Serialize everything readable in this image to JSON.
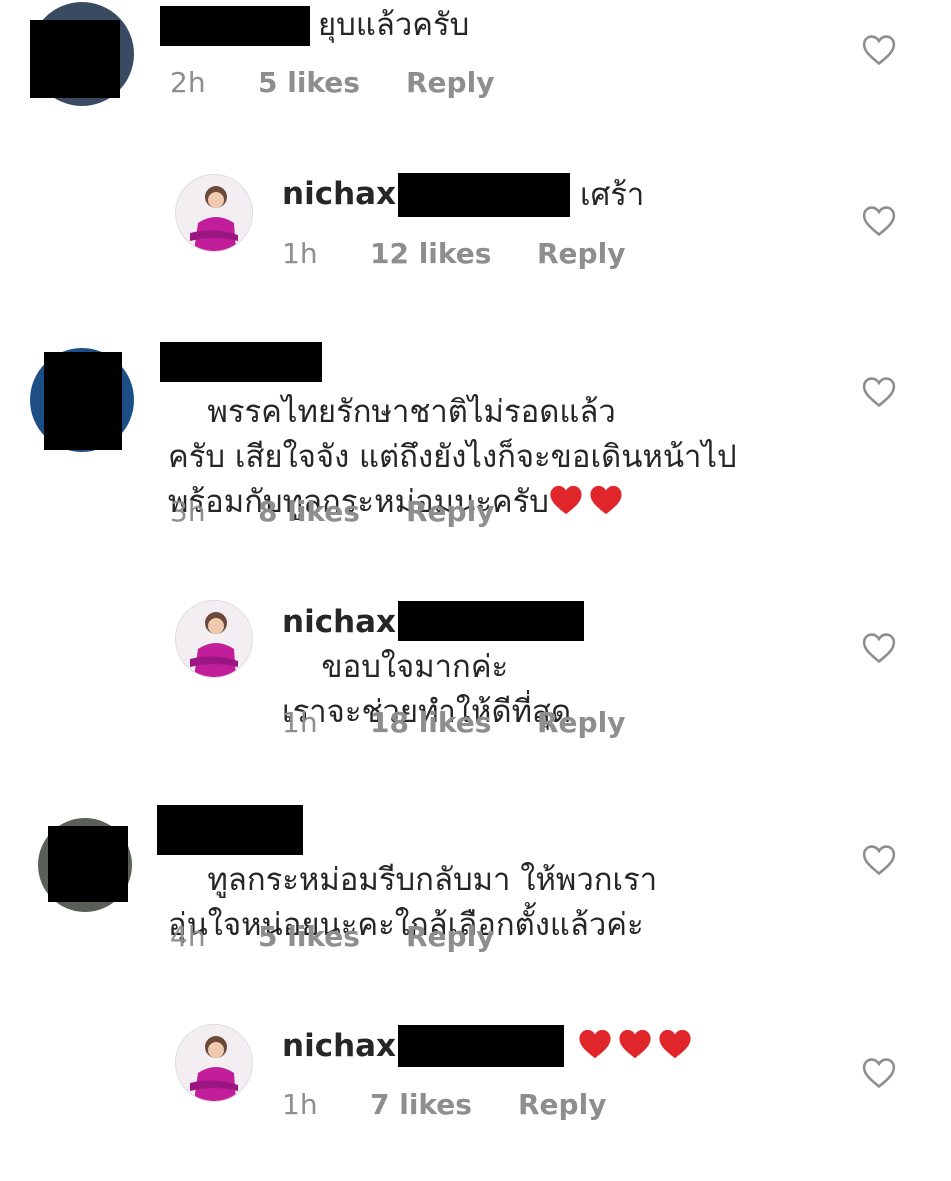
{
  "comments": [
    {
      "type": "commenter",
      "text": "ยุบแล้วครับ",
      "time": "2h",
      "likes": "5 likes",
      "reply": "Reply"
    },
    {
      "type": "reply",
      "username": "nichax",
      "text": "เศร้า",
      "time": "1h",
      "likes": "12 likes",
      "reply": "Reply"
    },
    {
      "type": "commenter",
      "text": "พรรคไทยรักษาชาติไม่รอดแล้ว\nครับ เสียใจจัง แต่ถึงยังไงก็จะขอเดินหน้าไป\nพร้อมกับทูลกระหม่อมนะครับ",
      "hearts": 2,
      "time": "3h",
      "likes": "8 likes",
      "reply": "Reply"
    },
    {
      "type": "reply",
      "username": "nichax",
      "text": "ขอบใจมากค่ะ\nเราจะช่วยทำให้ดีที่สุด",
      "time": "1h",
      "likes": "18 likes",
      "reply": "Reply"
    },
    {
      "type": "commenter",
      "text": "ทูลกระหม่อมรีบกลับมา ให้พวกเรา\nอุ่นใจหน่อยนะคะใกล้เลือกตั้งแล้วค่ะ",
      "time": "4h",
      "likes": "5 likes",
      "reply": "Reply"
    },
    {
      "type": "reply",
      "username": "nichax",
      "text": "",
      "hearts": 3,
      "time": "1h",
      "likes": "7 likes",
      "reply": "Reply"
    }
  ],
  "icons": {
    "like": "heart-outline-icon",
    "emoji": "red-heart-emoji-icon"
  },
  "colors": {
    "text": "#262626",
    "meta": "#8e8e8e",
    "heart_emoji": "#e0262a",
    "like_icon": "#8e8e8e"
  }
}
